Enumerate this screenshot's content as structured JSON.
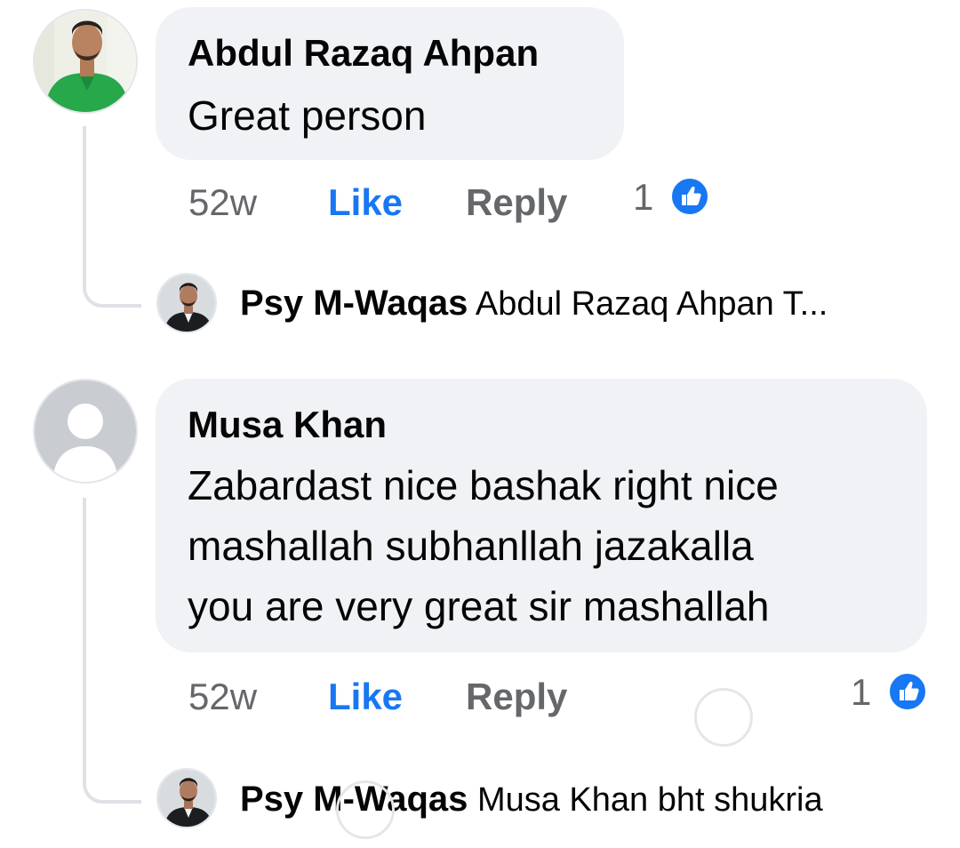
{
  "comments": [
    {
      "author": "Abdul Razaq Ahpan",
      "lines": [
        "Great person"
      ],
      "time": "52w",
      "like_label": "Like",
      "reply_label": "Reply",
      "reaction_count": "1",
      "reply": {
        "author": "Psy M-Waqas",
        "text": "Abdul Razaq Ahpan T..."
      }
    },
    {
      "author": "Musa Khan",
      "lines": [
        "Zabardast nice bashak right nice",
        "mashallah subhanllah jazakalla",
        "you are very great sir mashallah"
      ],
      "time": "52w",
      "like_label": "Like",
      "reply_label": "Reply",
      "reaction_count": "1",
      "reply": {
        "author": "Psy M-Waqas",
        "text": "Musa Khan bht shukria"
      }
    }
  ],
  "colors": {
    "bubble": "#f0f2f5",
    "like_blue": "#1877f2",
    "muted": "#65676b",
    "thread_line": "#dfe1e5"
  },
  "icons": {
    "reaction": "like-thumb-icon",
    "default_avatar": "default-profile-icon"
  }
}
